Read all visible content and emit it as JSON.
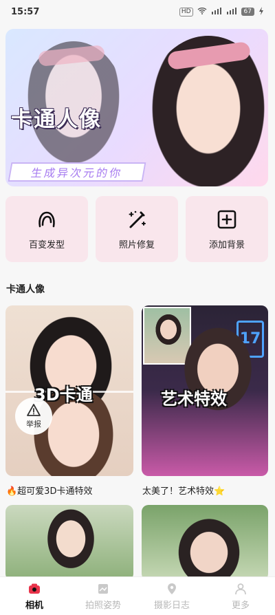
{
  "status": {
    "time": "15:57",
    "hd": "HD",
    "net1": "5G",
    "net2": "5G",
    "battery": "67"
  },
  "banner": {
    "title": "卡通人像",
    "subtitle": "生成异次元的你",
    "slides_total": 4,
    "active_slide": 1
  },
  "tools": [
    {
      "label": "百变发型",
      "icon": "hair-icon"
    },
    {
      "label": "照片修复",
      "icon": "magic-wand-icon"
    },
    {
      "label": "添加背景",
      "icon": "add-square-icon"
    }
  ],
  "section": {
    "title": "卡通人像"
  },
  "cards": [
    {
      "overlay": "3D卡通",
      "caption": "🔥超可爱3D卡通特效",
      "report_label": "举报"
    },
    {
      "overlay": "艺术特效",
      "caption": "太美了！艺术特效⭐",
      "sign": "17"
    },
    {
      "overlay": "",
      "caption": ""
    },
    {
      "overlay": "",
      "caption": ""
    }
  ],
  "tabbar": [
    {
      "label": "相机",
      "icon": "camera-icon",
      "active": true
    },
    {
      "label": "拍照姿势",
      "icon": "pose-image-icon",
      "active": false
    },
    {
      "label": "摄影日志",
      "icon": "location-pin-icon",
      "active": false
    },
    {
      "label": "更多",
      "icon": "user-icon",
      "active": false
    }
  ],
  "colors": {
    "accent": "#f06a8a",
    "tool_bg": "#f9e6ec",
    "active_tab": "#111111",
    "inactive_tab": "#b8b8b8"
  }
}
